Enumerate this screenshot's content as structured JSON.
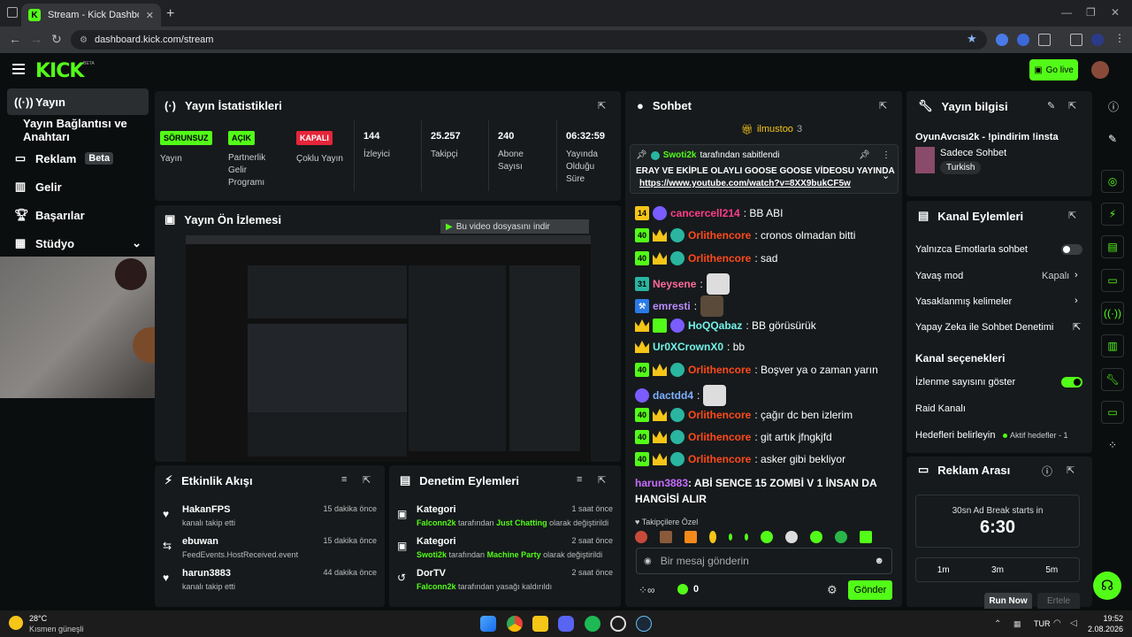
{
  "browser": {
    "tab_title": "Stream - Kick Dashboard",
    "url": "dashboard.kick.com/stream"
  },
  "header": {
    "logo": "KICK",
    "logo_badge": "BETA",
    "go_live": "Go live"
  },
  "sidebar": {
    "items": [
      {
        "label": "Yayın"
      },
      {
        "label": "Yayın Bağlantısı ve Anahtarı"
      },
      {
        "label": "Reklam",
        "badge": "Beta"
      },
      {
        "label": "Gelir"
      },
      {
        "label": "Başarılar"
      },
      {
        "label": "Stüdyo"
      }
    ]
  },
  "stats": {
    "title": "Yayın İstatistikleri",
    "items": [
      {
        "tag": "SÖRUNSUZ",
        "label": "Yayın"
      },
      {
        "tag": "AÇIK",
        "label": "Partnerlik Gelir Programı"
      },
      {
        "tag": "KAPALI",
        "label": "Çoklu Yayın"
      },
      {
        "value": "144",
        "label": "İzleyici"
      },
      {
        "value": "25.257",
        "label": "Takipçi"
      },
      {
        "value": "240",
        "label": "Abone Sayısı"
      },
      {
        "value": "06:32:59",
        "label": "Yayında Olduğu Süre"
      }
    ]
  },
  "preview": {
    "title": "Yayın Ön İzlemesi",
    "download_label": "Bu video dosyasını indir"
  },
  "activity": {
    "title": "Etkinlik Akışı",
    "items": [
      {
        "name": "HakanFPS",
        "sub": "kanalı takip etti",
        "time": "15 dakika önce"
      },
      {
        "name": "ebuwan",
        "sub": "FeedEvents.HostReceived.event",
        "time": "15 dakika önce"
      },
      {
        "name": "harun3883",
        "sub": "kanalı takip etti",
        "time": "44 dakika önce"
      }
    ]
  },
  "moderation": {
    "title": "Denetim Eylemleri",
    "items": [
      {
        "name": "Kategori",
        "user": "Falconn2k",
        "mid": "tarafından",
        "target": "Just Chatting",
        "end": "olarak değiştirildi",
        "time": "1 saat önce"
      },
      {
        "name": "Kategori",
        "user": "Swoti2k",
        "mid": "tarafından",
        "target": "Machine Party",
        "end": "olarak değiştirildi",
        "time": "2 saat önce"
      },
      {
        "name": "DorTV",
        "user": "Falconn2k",
        "mid": "tarafından yasağı kaldırıldı",
        "target": "",
        "end": "",
        "time": "2 saat önce"
      }
    ]
  },
  "chat": {
    "title": "Sohbet",
    "top_user": "ilmustoo",
    "top_count": "3",
    "pinned_by": "Swoti2k",
    "pinned_suffix": "tarafından sabitlendi",
    "pinned_text": "ERAY VE EKİPLE OLAYLI GOOSE GOOSE VİDEOSU YAYINDA",
    "pinned_link": "https://www.youtube.com/watch?v=8XX9bukCF5w",
    "messages": [
      {
        "level": "14",
        "user": "cancercell214",
        "text": ": BB ABI"
      },
      {
        "level": "40",
        "user": "Orlithencore",
        "text": ": cronos olmadan bitti"
      },
      {
        "level": "40",
        "user": "Orlithencore",
        "text": ": sad"
      },
      {
        "level": "31",
        "user": "Neysene",
        "text": ":"
      },
      {
        "level": "",
        "user": "emresti",
        "text": ":"
      },
      {
        "level": "",
        "user": "HoQQabaz",
        "text": ": BB görüsürük"
      },
      {
        "level": "",
        "user": "Ur0XCrownX0",
        "text": ": bb"
      },
      {
        "level": "40",
        "user": "Orlithencore",
        "text": ": Boşver ya o zaman yarın"
      },
      {
        "level": "",
        "user": "dactdd4",
        "text": ":"
      },
      {
        "level": "40",
        "user": "Orlithencore",
        "text": ": çağır dc ben izlerim"
      },
      {
        "level": "40",
        "user": "Orlithencore",
        "text": ": git artık jfngkjfd"
      },
      {
        "level": "40",
        "user": "Orlithencore",
        "text": ": asker gibi bekliyor"
      }
    ],
    "last_user": "harun3883",
    "last_text": ": ABİ SENCE 15 ZOMBİ V 1 İNSAN DA HANGİSİ ALIR",
    "followers_only": "Takipçilere Özel",
    "input_placeholder": "Bir mesaj gönderin",
    "count": "0",
    "send": "Gönder",
    "colors": {
      "orange": "#ff6a1a",
      "purple": "#b98cff",
      "blue": "#7fb0ff",
      "pink": "#ff3d8a",
      "teal": "#72f2e7"
    }
  },
  "stream_info": {
    "title": "Yayın bilgisi",
    "stream_title": "OyunAvcısı2k - !pindirim !insta",
    "category": "Sadece Sohbet",
    "language": "Turkish"
  },
  "channel_actions": {
    "title": "Kanal Eylemleri",
    "emote_only": "Yalnızca Emotlarla sohbet",
    "slow_mode": "Yavaş mod",
    "slow_value": "Kapalı",
    "banned_words": "Yasaklanmış kelimeler",
    "ai_mod": "Yapay Zeka ile Sohbet Denetimi",
    "options_title": "Kanal seçenekleri",
    "show_views": "İzlenme sayısını göster",
    "raid": "Raid Kanalı",
    "goals": "Hedefleri belirleyin",
    "goals_value": "Aktif hedefler - 1"
  },
  "ad_break": {
    "title": "Reklam Arası",
    "starts": "30sn Ad Break starts in",
    "timer": "6:30",
    "options": [
      "1m",
      "3m",
      "5m"
    ],
    "run_now": "Run Now",
    "snooze": "Ertele"
  },
  "taskbar": {
    "weather_temp": "28°C",
    "weather_desc": "Kısmen güneşli",
    "lang": "TUR",
    "time": "19:52",
    "date": "2.08.2026"
  }
}
